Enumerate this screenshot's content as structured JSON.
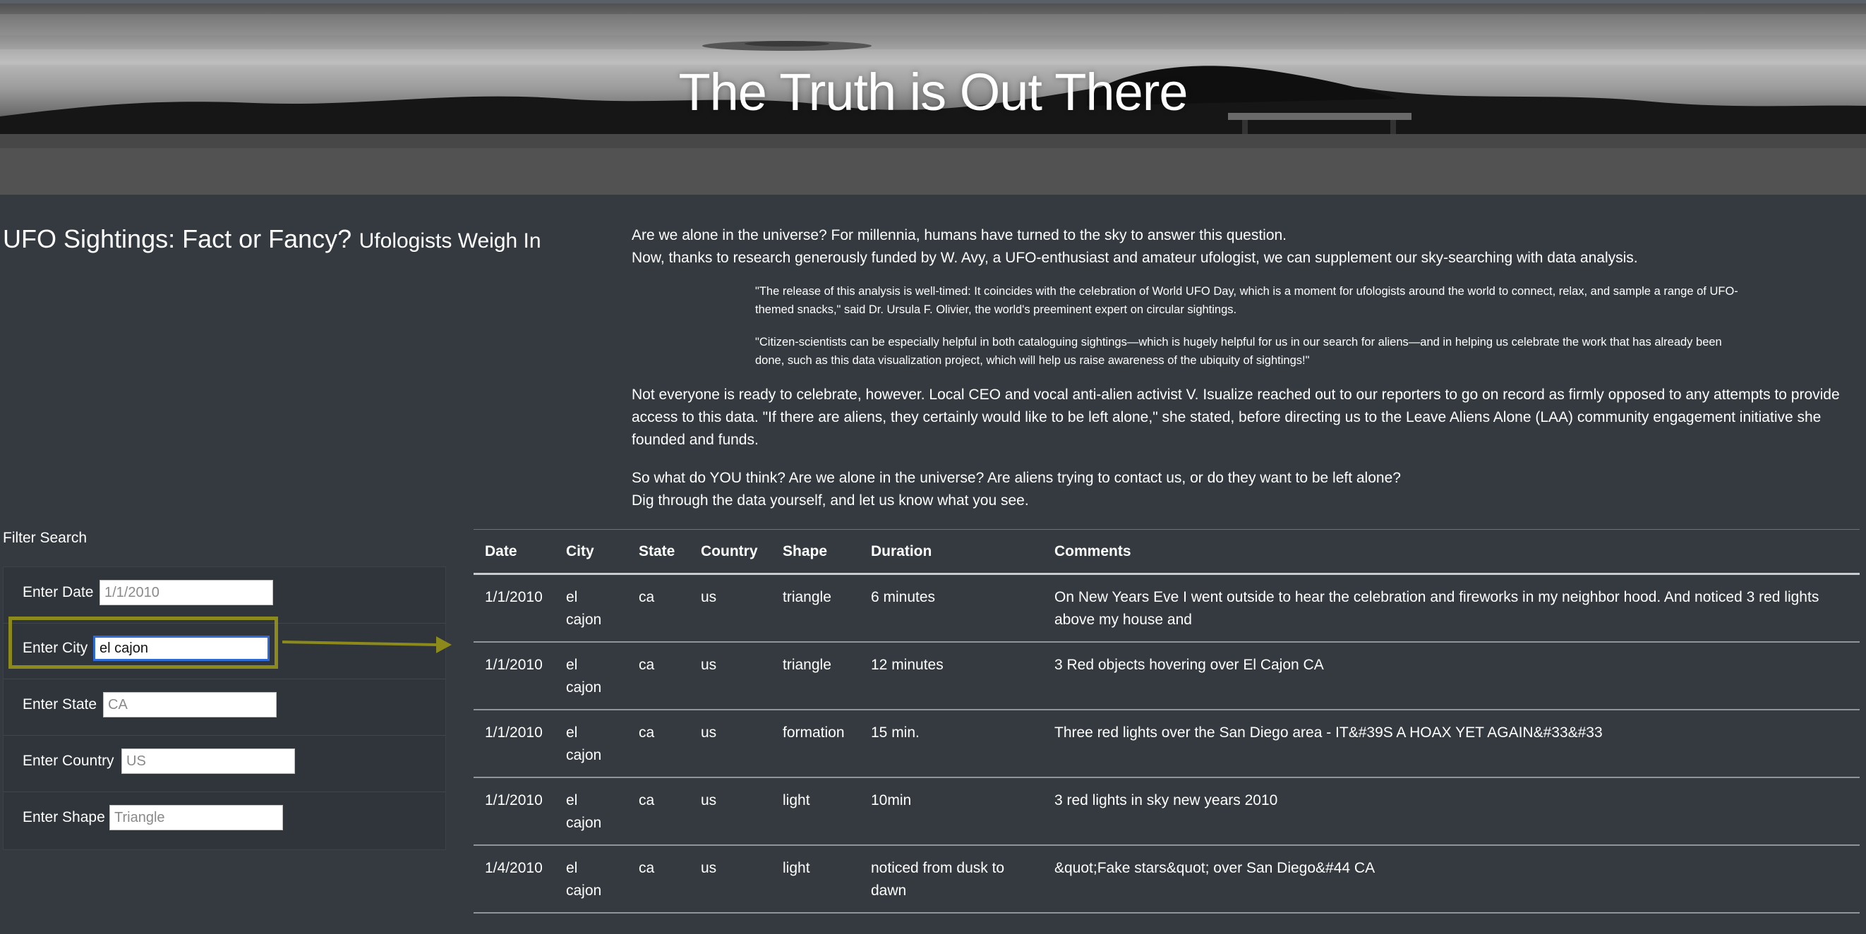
{
  "hero": {
    "title": "The Truth is Out There"
  },
  "heading": {
    "title": "UFO Sightings: Fact or Fancy?",
    "subtitle": "Ufologists Weigh In"
  },
  "article": {
    "intro_1": "Are we alone in the universe? For millennia, humans have turned to the sky to answer this question.",
    "intro_2": "Now, thanks to research generously funded by W. Avy, a UFO-enthusiast and amateur ufologist, we can supplement our sky-searching with data analysis.",
    "quote_1": "\"The release of this analysis is well-timed: It coincides with the celebration of World UFO Day, which is a moment for ufologists around the world to connect, relax, and sample a range of UFO-themed snacks,\" said Dr. Ursula F. Olivier, the world's preeminent expert on circular sightings.",
    "quote_2": "\"Citizen-scientists can be especially helpful in both cataloguing sightings—which is hugely helpful for us in our search for aliens—and in helping us celebrate the work that has already been done, such as this data visualization project, which will help us raise awareness of the ubiquity of sightings!\"",
    "para_3": "Not everyone is ready to celebrate, however. Local CEO and vocal anti-alien activist V. Isualize reached out to our reporters to go on record as firmly opposed to any attempts to provide access to this data. \"If there are aliens, they certainly would like to be left alone,\" she stated, before directing us to the Leave Aliens Alone (LAA) community engagement initiative she founded and funds.",
    "para_4a": "So what do YOU think? Are we alone in the universe? Are aliens trying to contact us, or do they want to be left alone?",
    "para_4b": "Dig through the data yourself, and let us know what you see."
  },
  "filters": {
    "title": "Filter Search",
    "date": {
      "label": "Enter Date",
      "placeholder": "1/1/2010",
      "value": ""
    },
    "city": {
      "label": "Enter City",
      "placeholder": "",
      "value": "el cajon"
    },
    "state": {
      "label": "Enter State",
      "placeholder": "CA",
      "value": ""
    },
    "country": {
      "label": "Enter Country",
      "placeholder": "US",
      "value": ""
    },
    "shape": {
      "label": "Enter Shape",
      "placeholder": "Triangle",
      "value": ""
    }
  },
  "table": {
    "headers": [
      "Date",
      "City",
      "State",
      "Country",
      "Shape",
      "Duration",
      "Comments"
    ],
    "rows": [
      [
        "1/1/2010",
        "el cajon",
        "ca",
        "us",
        "triangle",
        "6 minutes",
        "On New Years Eve I went outside to hear the celebration and fireworks in my neighbor hood. And noticed 3 red lights above my house and"
      ],
      [
        "1/1/2010",
        "el cajon",
        "ca",
        "us",
        "triangle",
        "12 minutes",
        "3 Red objects hovering over El Cajon CA"
      ],
      [
        "1/1/2010",
        "el cajon",
        "ca",
        "us",
        "formation",
        "15 min.",
        "Three red lights over the San Diego area - IT&#39S A HOAX YET AGAIN&#33&#33"
      ],
      [
        "1/1/2010",
        "el cajon",
        "ca",
        "us",
        "light",
        "10min",
        "3 red lights in sky new years 2010"
      ],
      [
        "1/4/2010",
        "el cajon",
        "ca",
        "us",
        "light",
        "noticed from dusk to dawn",
        "&quot;Fake stars&quot; over San Diego&#44 CA"
      ]
    ]
  },
  "colors": {
    "page_bg": "#343a40",
    "highlight": "#8d8a1c",
    "focus_border": "#2f6bd8"
  }
}
